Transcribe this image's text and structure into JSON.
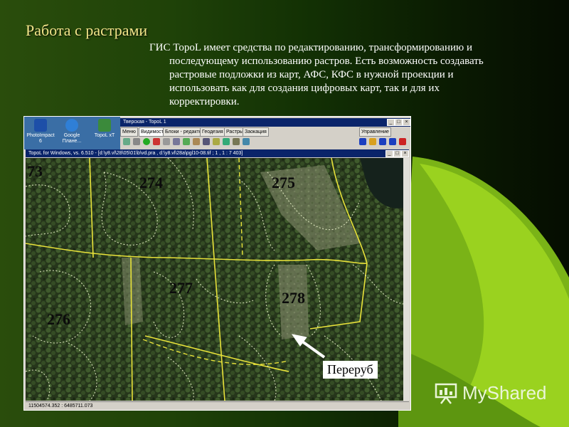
{
  "slide": {
    "title": "Работа с растрами",
    "text_lines": [
      "ГИС TopoL имеет средства по редактированию, трансформированию и",
      "последующему использованию растров. Есть возможность создавать",
      "растровые подложки из карт, АФС, КФС в нужной проекции и",
      "использовать как для создания цифровых карт, так и для их",
      "корректировки."
    ]
  },
  "desktop_icons": [
    {
      "label": "PhotoImpact 6",
      "color": "#1d4fa8"
    },
    {
      "label": "Google Плане...",
      "color": "#2f7fd6"
    },
    {
      "label": "TopoL xT",
      "color": "#3b8a3b"
    }
  ],
  "app_window": {
    "title": "Тверская - TopoL 1",
    "tabs": [
      "Меню",
      "Видимость",
      "Блоки - редактор",
      "Геодезия",
      "Растры",
      "Заокация",
      "Управление"
    ],
    "map_window_title": "TopoL for Windows, vs. 6.510 - [d:\\y8.vl\\28\\05\\01\\b\\vd.pra , d:\\y8.vl\\28a\\pgl10-08.tif ; 1 , 1 : 7 403]",
    "status_coords": "11504574.352 : 6485711.073"
  },
  "map": {
    "stand_labels": [
      "73",
      "274",
      "275",
      "277",
      "278",
      "276"
    ],
    "annotation": "Переруб"
  },
  "brand": {
    "name": "MyShared"
  },
  "colors": {
    "title": "#f3e68a",
    "accent_green": "#8ecf1a",
    "boundary_yellow": "#e8e23a"
  }
}
